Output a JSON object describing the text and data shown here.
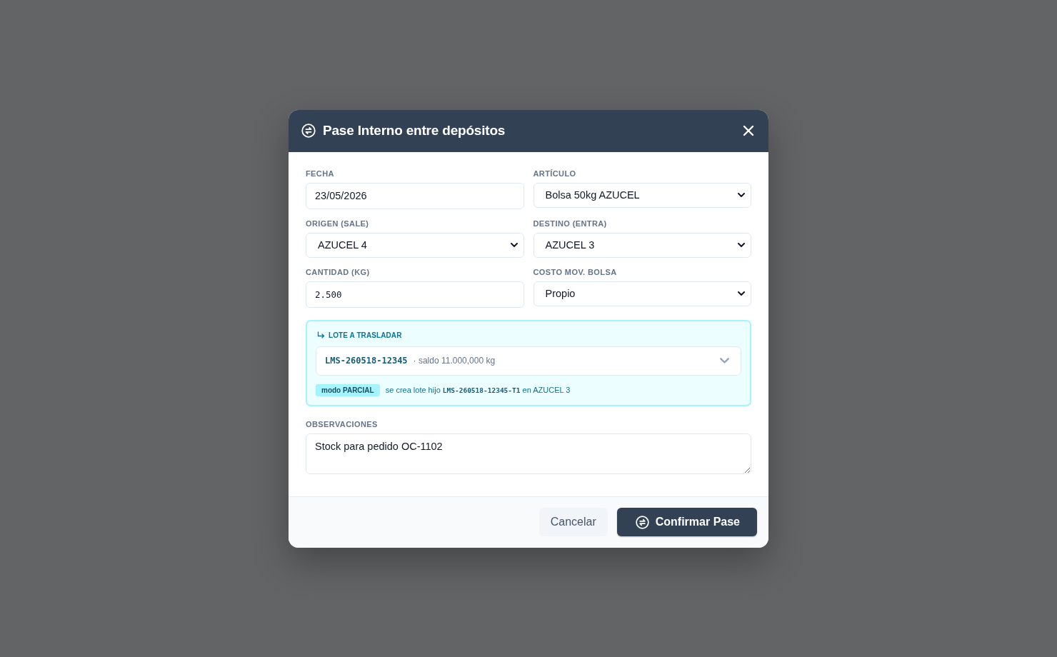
{
  "dialog": {
    "title": "Pase Interno entre depósitos",
    "fields": [
      {
        "kind": "input",
        "label": "FECHA",
        "value": "23/05/2026"
      },
      {
        "kind": "select",
        "label": "ARTÍCULO",
        "value": "Bolsa 50kg AZUCEL"
      },
      {
        "kind": "select",
        "label": "ORIGEN (SALE)",
        "value": "AZUCEL 4"
      },
      {
        "kind": "select",
        "label": "DESTINO (ENTRA)",
        "value": "AZUCEL 3"
      },
      {
        "kind": "number",
        "label": "CANTIDAD (KG)",
        "value": "2.500"
      },
      {
        "kind": "select",
        "label": "COSTO MOV. BOLSA",
        "value": "Propio"
      }
    ],
    "lote": {
      "heading": "LOTE A TRASLADAR",
      "code": "LMS-260518-12345",
      "detail": "· saldo 11.000,000 kg",
      "badge": "modo PARCIAL",
      "note": [
        {
          "kind": "text",
          "text": "se crea lote hijo"
        },
        {
          "kind": "code",
          "text": "LMS-260518-12345-T1"
        },
        {
          "kind": "text",
          "text": "en AZUCEL 3"
        }
      ]
    },
    "observations": {
      "label": "OBSERVACIONES",
      "value": "Stock para pedido OC-1102"
    },
    "buttons": [
      {
        "kind": "secondary",
        "label": "Cancelar"
      },
      {
        "kind": "primary",
        "label": "Confirmar Pase"
      }
    ]
  }
}
